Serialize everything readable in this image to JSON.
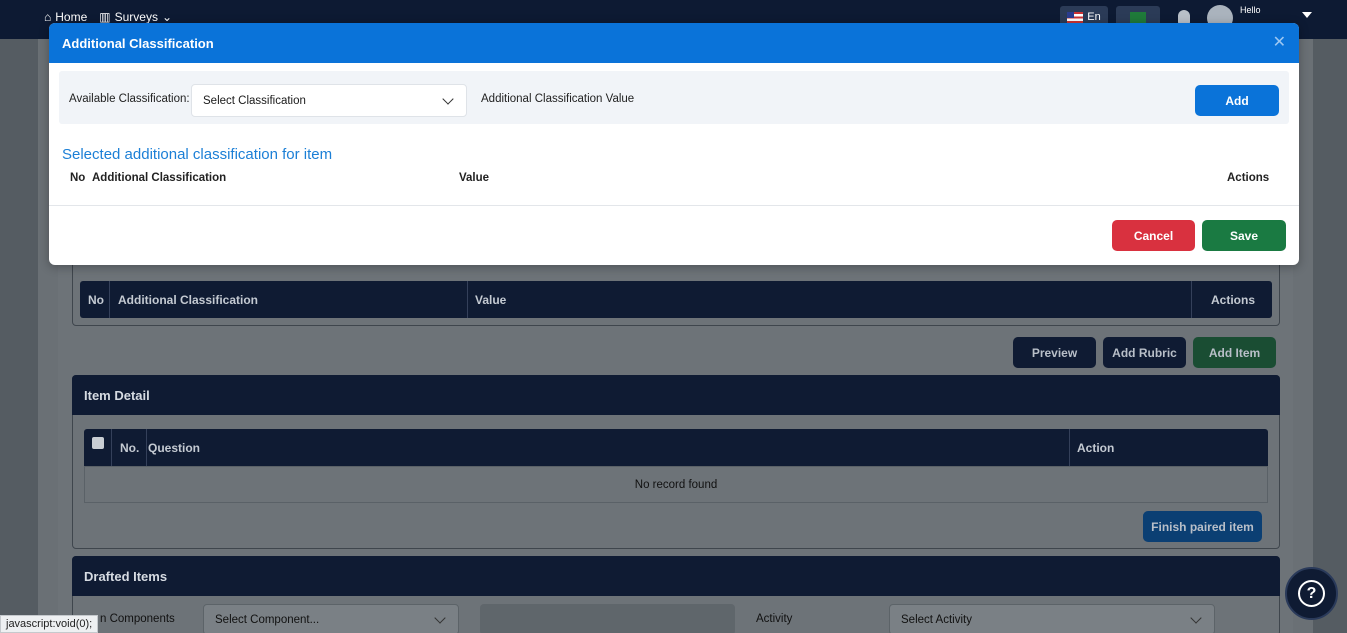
{
  "topbar": {
    "nav": [
      {
        "icon": "home-icon",
        "label": "Home"
      },
      {
        "icon": "book-icon",
        "label": "Surveys"
      }
    ],
    "language": "En",
    "greeting": "Hello"
  },
  "modal": {
    "title": "Additional Classification",
    "available_label": "Available Classification:",
    "select_value": "Select Classification",
    "value_label": "Additional Classification Value",
    "add_label": "Add",
    "section_title": "Selected additional classification for item",
    "columns": {
      "no": "No",
      "classification": "Additional Classification",
      "value": "Value",
      "actions": "Actions"
    },
    "cancel_label": "Cancel",
    "save_label": "Save"
  },
  "background": {
    "table_columns": {
      "no": "No",
      "classification": "Additional Classification",
      "value": "Value",
      "actions": "Actions"
    },
    "buttons": {
      "preview": "Preview",
      "add_rubric": "Add Rubric",
      "add_item": "Add Item"
    },
    "item_detail": {
      "title": "Item Detail",
      "columns": {
        "no": "No.",
        "question": "Question",
        "action": "Action"
      },
      "empty": "No record found",
      "finish_label": "Finish paired item"
    },
    "drafted": {
      "title": "Drafted Items",
      "components_label": "n Components",
      "component_select": "Select Component...",
      "activity_label": "Activity",
      "activity_select": "Select Activity"
    }
  },
  "status_url": "javascript:void(0);",
  "colors": {
    "primary": "#0a73d9",
    "danger": "#d9313f",
    "success": "#1a7a42",
    "navy": "#0f1b33"
  }
}
